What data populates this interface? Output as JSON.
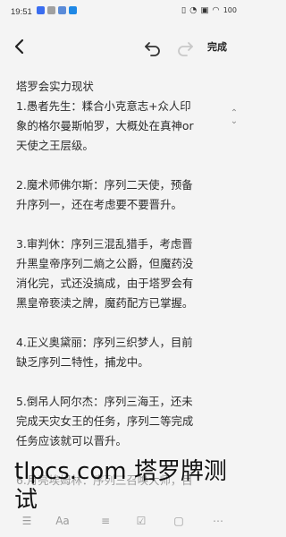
{
  "status": {
    "time": "19:51",
    "battery": "100"
  },
  "toolbar": {
    "done_label": "完成"
  },
  "note": {
    "lines": [
      "塔罗会实力现状",
      "1.愚者先生：糅合小克意志+众人印",
      "象的格尔曼斯帕罗，大概处在真神or",
      "天使之王层级。",
      "",
      "2.魔术师佛尔斯：序列二天使，预备",
      "升序列一，还在考虑要不要晋升。",
      "",
      "3.审判休：序列三混乱猎手，考虑晋",
      "升黑皇帝序列二熵之公爵，但魔药没",
      "消化完，式还没搞成，由于塔罗会有",
      "黑皇帝亵渎之牌，魔药配方已掌握。",
      "",
      "4.正义奥黛丽：序列三织梦人，目前",
      "缺乏序列二特性，捕龙中。",
      "",
      "5.倒吊人阿尔杰：序列三海王，还未",
      "完成天灾女王的任务，序列二等完成",
      "任务应该就可以晋升。",
      "",
      "6.月亮埃姆林：序列三召唤大师，目"
    ]
  },
  "watermark": "tlpcs.com 塔罗牌测试"
}
